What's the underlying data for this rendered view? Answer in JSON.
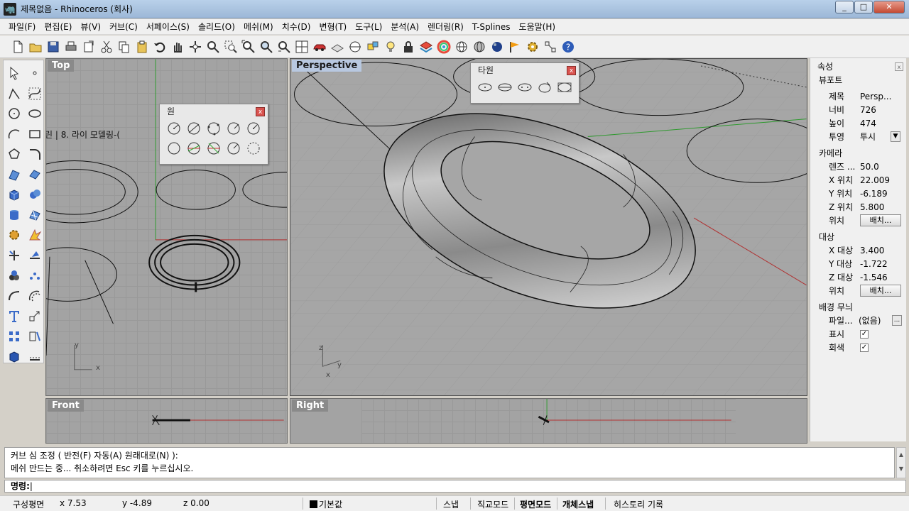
{
  "window": {
    "title": "제목없음 - Rhinoceros (회사)",
    "btn_min": "_",
    "btn_max": "□",
    "btn_close": "✕"
  },
  "menu": [
    "파일(F)",
    "편집(E)",
    "뷰(V)",
    "커브(C)",
    "서페이스(S)",
    "솔리드(O)",
    "메쉬(M)",
    "치수(D)",
    "변형(T)",
    "도구(L)",
    "분석(A)",
    "렌더링(R)",
    "T-Splines",
    "도움말(H)"
  ],
  "viewports": {
    "top": "Top",
    "perspective": "Perspective",
    "front": "Front",
    "right": "Right"
  },
  "top_viewport_text": "린 | 8. 라이 모델링-(",
  "axis_labels": {
    "x": "x",
    "y": "y",
    "z": "z"
  },
  "palettes": {
    "circle_title": "원",
    "ellipse_title": "타원",
    "close_glyph": "x"
  },
  "properties": {
    "title": "속성",
    "viewport_section": "뷰포트",
    "rows_viewport": [
      {
        "key": "제목",
        "value": "Persp..."
      },
      {
        "key": "너비",
        "value": "726"
      },
      {
        "key": "높이",
        "value": "474"
      },
      {
        "key": "투영",
        "value": "투시"
      }
    ],
    "camera_section": "카메라",
    "rows_camera": [
      {
        "key": "렌즈 ...",
        "value": "50.0"
      },
      {
        "key": "X 위치",
        "value": "22.009"
      },
      {
        "key": "Y 위치",
        "value": "-6.189"
      },
      {
        "key": "Z 위치",
        "value": "5.800"
      }
    ],
    "camera_pos_key": "위치",
    "target_section": "대상",
    "rows_target": [
      {
        "key": "X 대상",
        "value": "3.400"
      },
      {
        "key": "Y 대상",
        "value": "-1.722"
      },
      {
        "key": "Z 대상",
        "value": "-1.546"
      }
    ],
    "target_pos_key": "위치",
    "place_button": "배치...",
    "bg_section": "배경 무늬",
    "bg_file_key": "파일...",
    "bg_file_value": "(없음)",
    "bg_more": "...",
    "bg_show_key": "표시",
    "bg_gray_key": "회색",
    "check_mark": "✓",
    "dropdown_glyph": "▼"
  },
  "command": {
    "history": [
      "커브 심 조정 ( 반전(F) 자동(A) 원래대로(N) ):",
      "메쉬 만드는 중... 취소하려면 Esc 키를 누르십시오."
    ],
    "prompt": "명령:",
    "scroll_up": "▲",
    "scroll_down": "▼"
  },
  "status": {
    "cplane": "구성평면",
    "x": "x 7.53",
    "y": "y -4.89",
    "z": "z 0.00",
    "layer": "기본값",
    "snap": "스냅",
    "ortho": "직교모드",
    "planar": "평면모드",
    "osnap": "개체스냅",
    "history": "히스토리 기록"
  },
  "colors": {
    "viewport_bg": "#a3a3a3",
    "grid": "#999999",
    "x_axis": "#b03030",
    "y_axis": "#2f9a2f",
    "active_label": "#b8c8e0"
  }
}
